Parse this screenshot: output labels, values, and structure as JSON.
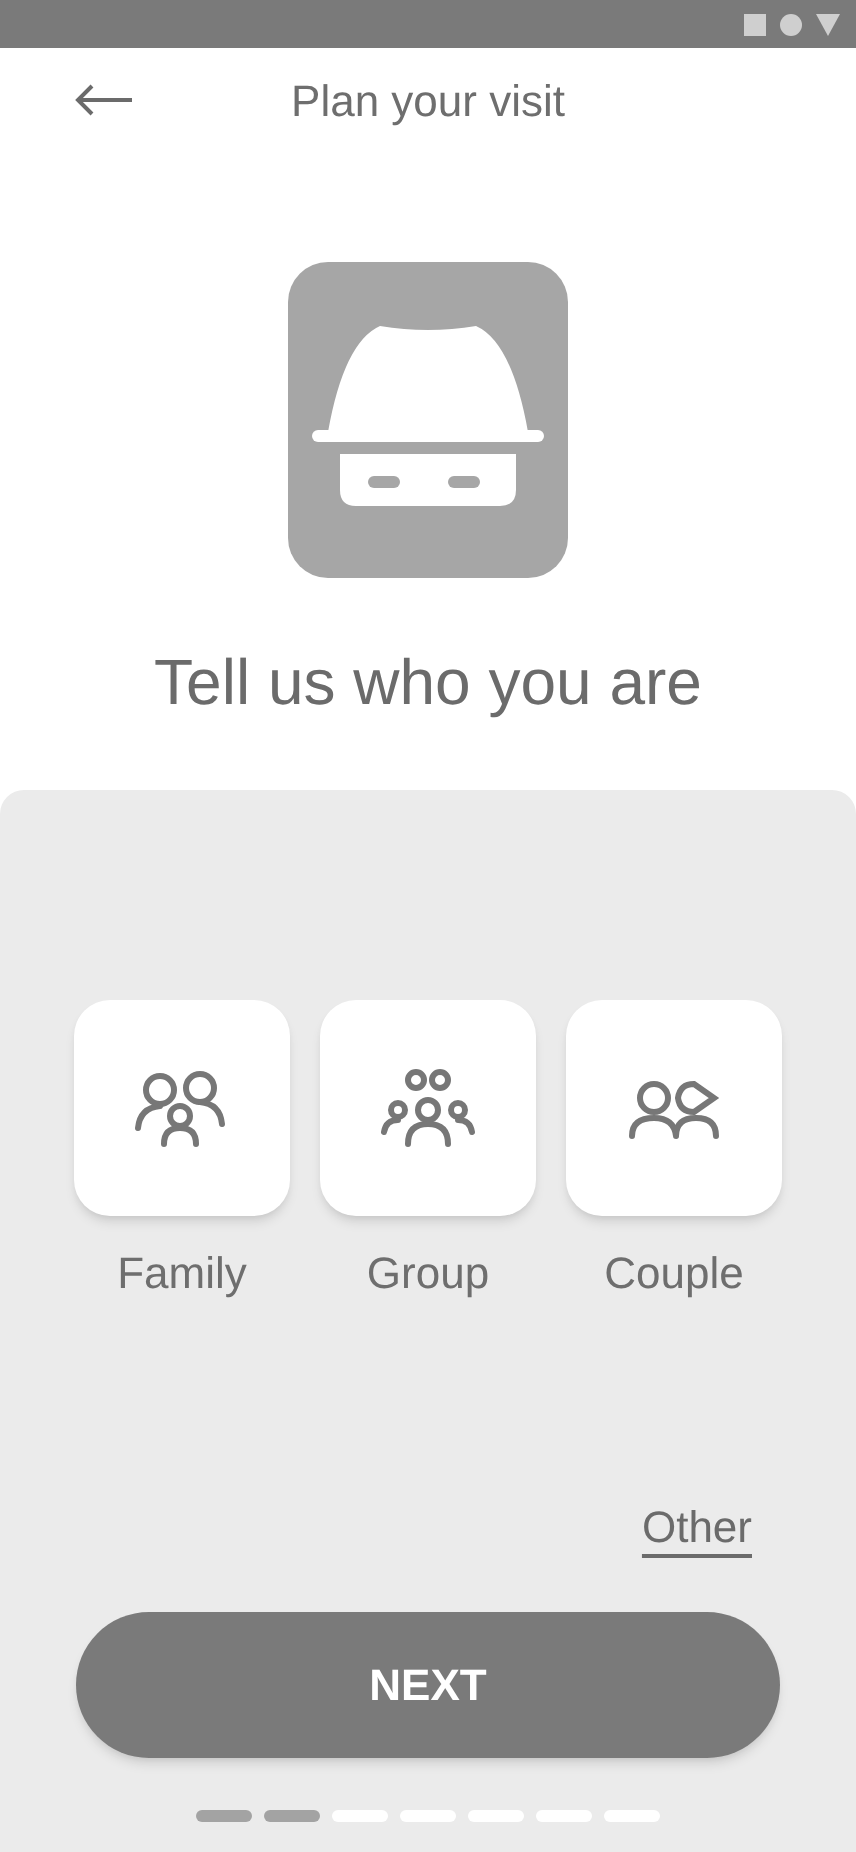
{
  "header": {
    "title": "Plan your visit"
  },
  "heading": "Tell us who you are",
  "options": [
    {
      "kind": "family",
      "label": "Family",
      "selected": false
    },
    {
      "kind": "group",
      "label": "Group",
      "selected": false
    },
    {
      "kind": "couple",
      "label": "Couple",
      "selected": false
    }
  ],
  "other_link": "Other",
  "next_button": "NEXT",
  "progress_steps": [
    {
      "done": true
    },
    {
      "done": true
    },
    {
      "done": false
    },
    {
      "done": false
    },
    {
      "done": false
    },
    {
      "done": false
    },
    {
      "done": false
    }
  ]
}
